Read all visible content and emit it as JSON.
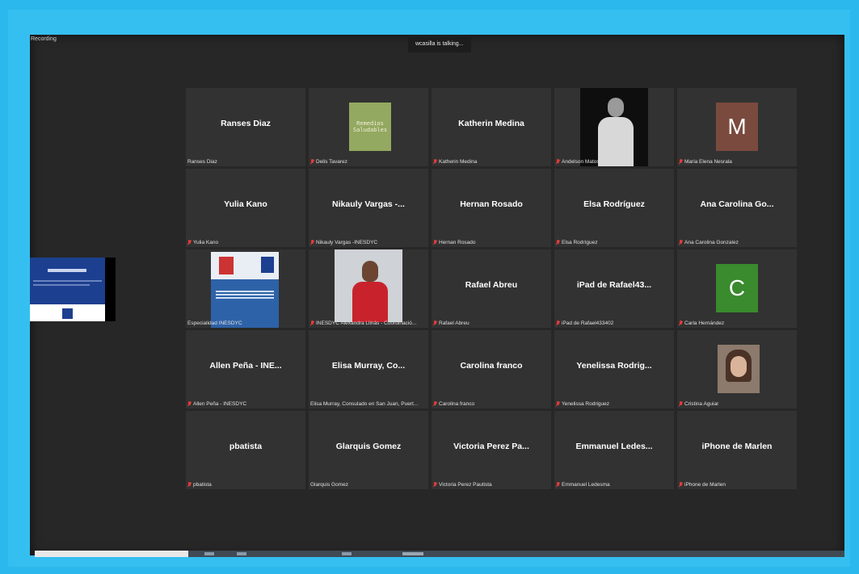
{
  "meeting": {
    "recording_label": "Recording",
    "talking_indicator": "wcasilla is talking..."
  },
  "participants": [
    {
      "display": "Ranses Diaz",
      "label": "Ranses Diaz",
      "muted": false,
      "avatar": "none"
    },
    {
      "display": "",
      "label": "Delis Tavarez",
      "muted": true,
      "avatar": "remedios",
      "avatar_text": "Remedios Saludables"
    },
    {
      "display": "Katherin Medina",
      "label": "Katherin Medina",
      "muted": true,
      "avatar": "none"
    },
    {
      "display": "",
      "label": "Andelson Matos",
      "muted": true,
      "avatar": "photo-man"
    },
    {
      "display": "",
      "label": "Maria Elena Nesrala",
      "muted": true,
      "avatar": "letter",
      "avatar_letter": "M",
      "avatar_color": "#7a4a3e"
    },
    {
      "display": "Yulia Kano",
      "label": "Yulia Kano",
      "muted": true,
      "avatar": "none"
    },
    {
      "display": "Nikauly Vargas -...",
      "label": "Nikauly Vargas -INESDYC",
      "muted": true,
      "avatar": "none"
    },
    {
      "display": "Hernan Rosado",
      "label": "Hernan Rosado",
      "muted": true,
      "avatar": "none"
    },
    {
      "display": "Elsa Rodríguez",
      "label": "Elsa Rodríguez",
      "muted": true,
      "avatar": "none"
    },
    {
      "display": "Ana Carolina Go...",
      "label": "Ana Carolina Gonzalez",
      "muted": true,
      "avatar": "none"
    },
    {
      "display": "",
      "label": "Especialidad INESDYC",
      "muted": false,
      "avatar": "document"
    },
    {
      "display": "",
      "label": "INESDYC Alexandra Llinás - Coordinació...",
      "muted": true,
      "avatar": "photo-woman"
    },
    {
      "display": "Rafael Abreu",
      "label": "Rafael Abreu",
      "muted": true,
      "avatar": "none"
    },
    {
      "display": "iPad de Rafael43...",
      "label": "iPad de Rafael433402",
      "muted": true,
      "avatar": "none"
    },
    {
      "display": "",
      "label": "Carla Hernández",
      "muted": true,
      "avatar": "letter",
      "avatar_letter": "C",
      "avatar_color": "#3a8a2e"
    },
    {
      "display": "Allen Peña - INE...",
      "label": "Allen Peña - INESDYC",
      "muted": true,
      "avatar": "none"
    },
    {
      "display": "Elisa Murray, Co...",
      "label": "Elisa Murray, Consulado en San Juan, Puert...",
      "muted": false,
      "avatar": "none"
    },
    {
      "display": "Carolina franco",
      "label": "Carolina franco",
      "muted": true,
      "avatar": "none"
    },
    {
      "display": "Yenelissa  Rodrig...",
      "label": "Yenelissa Rodriguez",
      "muted": true,
      "avatar": "none"
    },
    {
      "display": "",
      "label": "Cristina Aguiar",
      "muted": true,
      "avatar": "photo-woman2"
    },
    {
      "display": "pbatista",
      "label": "pbatista",
      "muted": true,
      "avatar": "none"
    },
    {
      "display": "Glarquis Gomez",
      "label": "Glarquis Gomez",
      "muted": false,
      "avatar": "none"
    },
    {
      "display": "Victoria Perez Pa...",
      "label": "Victoria Perez Pautista",
      "muted": true,
      "avatar": "none"
    },
    {
      "display": "Emmanuel  Ledes...",
      "label": "Emmanuel Ledesma",
      "muted": true,
      "avatar": "none"
    },
    {
      "display": "iPhone de Marlen",
      "label": "iPhone de Marlen",
      "muted": true,
      "avatar": "none"
    }
  ],
  "colors": {
    "screen_border": "#2bb8ec",
    "tile_bg": "#323232",
    "muted_icon": "#e23b3b"
  }
}
